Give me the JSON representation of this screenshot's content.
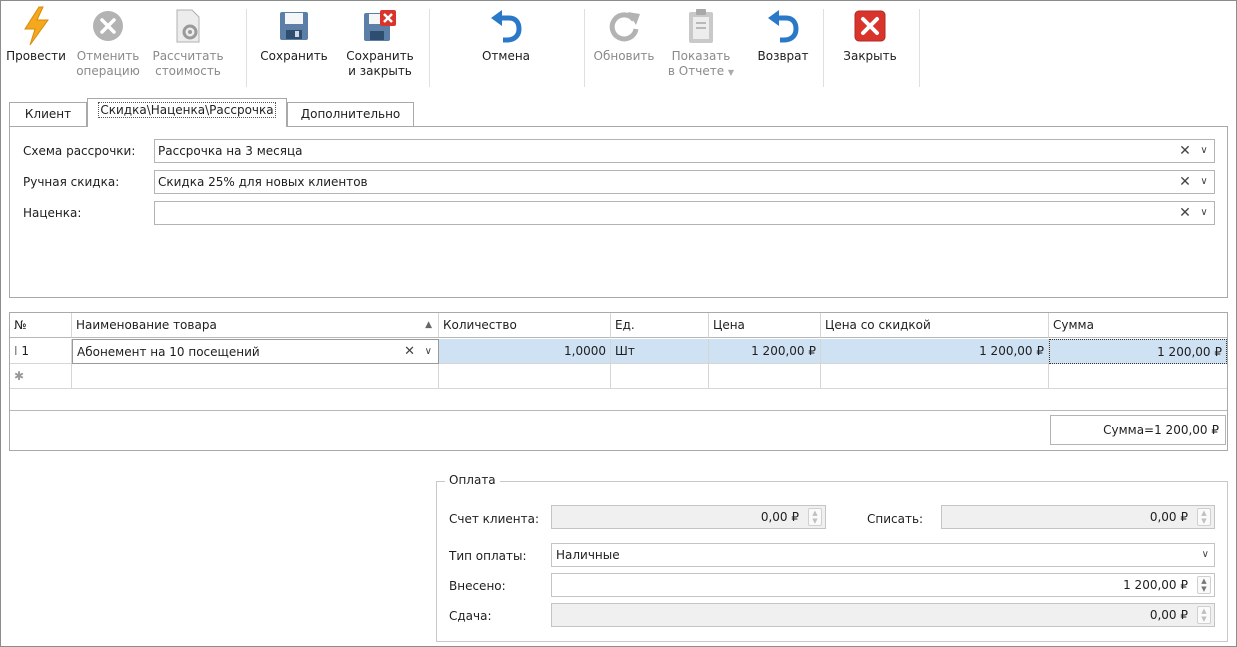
{
  "toolbar": {
    "provesti": "Провести",
    "otmenit_1": "Отменить",
    "otmenit_2": "операцию",
    "rasschitat_1": "Рассчитать",
    "rasschitat_2": "стоимость",
    "sohranit": "Сохранить",
    "sohranit_zakr_1": "Сохранить",
    "sohranit_zakr_2": "и закрыть",
    "otmena": "Отмена",
    "obnovit": "Обновить",
    "pokazat_1": "Показать",
    "pokazat_2": "в Отчете",
    "vozvrat": "Возврат",
    "zakryt": "Закрыть"
  },
  "tabs": [
    "Клиент",
    "Скидка\\Наценка\\Рассрочка",
    "Дополнительно"
  ],
  "form": {
    "installment_label": "Схема рассрочки:",
    "installment_value": "Рассрочка на 3 месяца",
    "discount_label": "Ручная скидка:",
    "discount_value": "Скидка 25% для новых клиентов",
    "markup_label": "Наценка:",
    "markup_value": ""
  },
  "grid": {
    "columns": [
      "№",
      "Наименование товара",
      "Количество",
      "Ед.",
      "Цена",
      "Цена со скидкой",
      "Сумма"
    ],
    "rows": [
      {
        "num": "1",
        "name": "Абонемент на 10 посещений",
        "qty": "1,0000",
        "unit": "Шт",
        "price": "1 200,00 ₽",
        "disc_price": "1 200,00 ₽",
        "sum": "1 200,00 ₽"
      }
    ],
    "total": "Сумма=1 200,00 ₽"
  },
  "payment": {
    "title": "Оплата",
    "account_label": "Счет клиента:",
    "account_value": "0,00 ₽",
    "writeoff_label": "Списать:",
    "writeoff_value": "0,00 ₽",
    "type_label": "Тип оплаты:",
    "type_value": "Наличные",
    "paid_label": "Внесено:",
    "paid_value": "1 200,00 ₽",
    "change_label": "Сдача:",
    "change_value": "0,00 ₽"
  },
  "colors": {
    "selection": "#cfe2f3",
    "close_red": "#d9342b",
    "undo_blue": "#2a78c8",
    "bolt_orange": "#f4a81d"
  }
}
